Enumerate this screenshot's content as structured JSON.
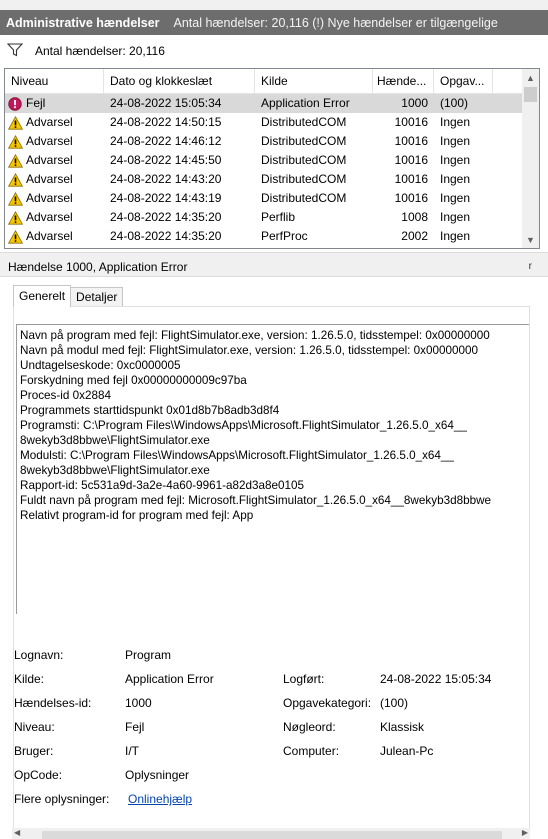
{
  "window": {
    "title": "Administrative hændelser",
    "subtitle": "Antal hændelser: 20,116 (!) Nye hændelser er tilgængelige"
  },
  "filter": {
    "icon": "filter-icon",
    "count_text": "Antal hændelser: 20,116"
  },
  "list": {
    "columns": [
      "Niveau",
      "Dato og klokkeslæt",
      "Kilde",
      "Hænde...",
      "Opgav..."
    ],
    "rows": [
      {
        "level": "Fejl",
        "icon": "error-icon",
        "date": "24-08-2022 15:05:34",
        "source": "Application Error",
        "id": "1000",
        "task": "(100)"
      },
      {
        "level": "Advarsel",
        "icon": "warning-icon",
        "date": "24-08-2022 14:50:15",
        "source": "DistributedCOM",
        "id": "10016",
        "task": "Ingen"
      },
      {
        "level": "Advarsel",
        "icon": "warning-icon",
        "date": "24-08-2022 14:46:12",
        "source": "DistributedCOM",
        "id": "10016",
        "task": "Ingen"
      },
      {
        "level": "Advarsel",
        "icon": "warning-icon",
        "date": "24-08-2022 14:45:50",
        "source": "DistributedCOM",
        "id": "10016",
        "task": "Ingen"
      },
      {
        "level": "Advarsel",
        "icon": "warning-icon",
        "date": "24-08-2022 14:43:20",
        "source": "DistributedCOM",
        "id": "10016",
        "task": "Ingen"
      },
      {
        "level": "Advarsel",
        "icon": "warning-icon",
        "date": "24-08-2022 14:43:19",
        "source": "DistributedCOM",
        "id": "10016",
        "task": "Ingen"
      },
      {
        "level": "Advarsel",
        "icon": "warning-icon",
        "date": "24-08-2022 14:35:20",
        "source": "Perflib",
        "id": "1008",
        "task": "Ingen"
      },
      {
        "level": "Advarsel",
        "icon": "warning-icon",
        "date": "24-08-2022 14:35:20",
        "source": "PerfProc",
        "id": "2002",
        "task": "Ingen"
      }
    ]
  },
  "detail": {
    "header": "Hændelse 1000, Application Error",
    "close_glyph": "r",
    "tabs": [
      "Generelt",
      "Detaljer"
    ],
    "description_lines": [
      "Navn på program med fejl: FlightSimulator.exe, version: 1.26.5.0, tidsstempel: 0x00000000",
      "Navn på modul med fejl: FlightSimulator.exe, version: 1.26.5.0, tidsstempel: 0x00000000",
      "Undtagelseskode: 0xc0000005",
      "Forskydning med fejl 0x00000000009c97ba",
      "Proces-id 0x2884",
      "Programmets starttidspunkt 0x01d8b7b8adb3d8f4",
      "Programsti: C:\\Program Files\\WindowsApps\\Microsoft.FlightSimulator_1.26.5.0_x64__",
      "8wekyb3d8bbwe\\FlightSimulator.exe",
      "Modulsti: C:\\Program Files\\WindowsApps\\Microsoft.FlightSimulator_1.26.5.0_x64__",
      "8wekyb3d8bbwe\\FlightSimulator.exe",
      "Rapport-id: 5c531a9d-3a2e-4a60-9961-a82d3a8e0105",
      "Fuldt navn på program med fejl: Microsoft.FlightSimulator_1.26.5.0_x64__8wekyb3d8bbwe",
      "Relativt program-id for program med fejl: App"
    ],
    "props": {
      "logname_label": "Lognavn:",
      "logname_value": "Program",
      "source_label": "Kilde:",
      "source_value": "Application Error",
      "logged_label": "Logført:",
      "logged_value": "24-08-2022 15:05:34",
      "eventid_label": "Hændelses-id:",
      "eventid_value": "1000",
      "taskcat_label": "Opgavekategori:",
      "taskcat_value": "(100)",
      "level_label": "Niveau:",
      "level_value": "Fejl",
      "keywords_label": "Nøgleord:",
      "keywords_value": "Klassisk",
      "user_label": "Bruger:",
      "user_value": "I/T",
      "computer_label": "Computer:",
      "computer_value": "Julean-Pc",
      "opcode_label": "OpCode:",
      "opcode_value": "Oplysninger",
      "moreinfo_label": "Flere oplysninger:",
      "moreinfo_link": "Onlinehjælp"
    }
  }
}
